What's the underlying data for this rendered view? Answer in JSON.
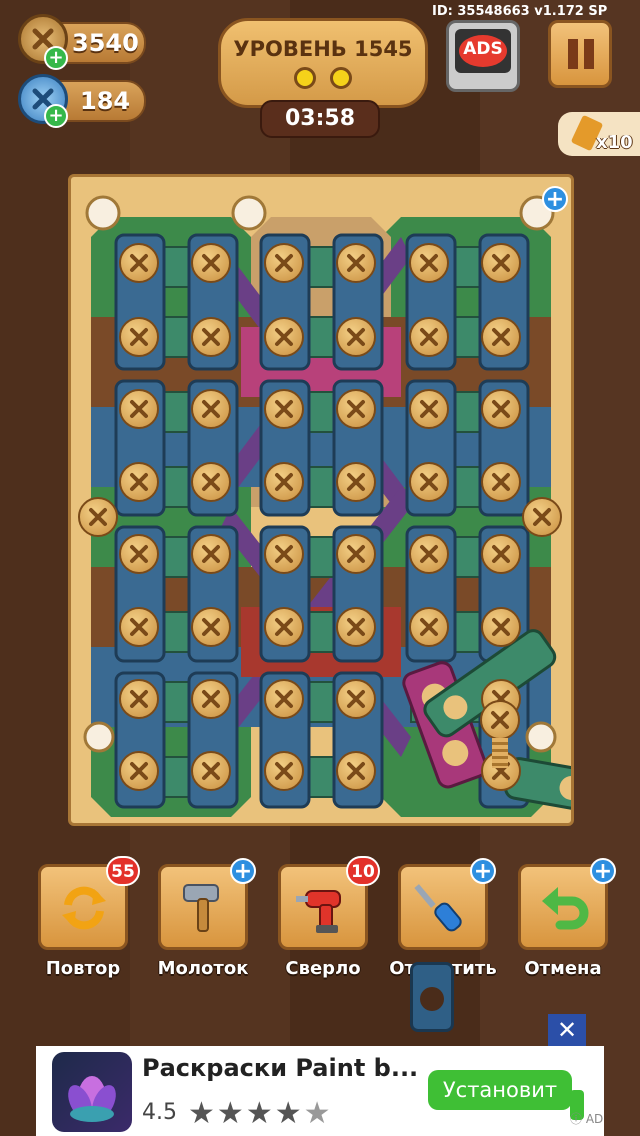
{
  "hud": {
    "coins": "3540",
    "gems": "184",
    "build_info": "ID: 35548663 v1.172 SP",
    "level_label": "УРОВЕНЬ 1545",
    "timer": "03:58",
    "ads_label": "ADS",
    "hint_count": "x10"
  },
  "toolbar": [
    {
      "name": "tool-replay",
      "label": "Повтор",
      "badge": "55",
      "badge_type": "count",
      "icon": "replay-arrows-icon"
    },
    {
      "name": "tool-hammer",
      "label": "Молоток",
      "badge": "+",
      "badge_type": "plus",
      "icon": "hammer-icon"
    },
    {
      "name": "tool-drill",
      "label": "Сверло",
      "badge": "10",
      "badge_type": "count",
      "icon": "drill-icon"
    },
    {
      "name": "tool-unscrew",
      "label": "Открутить",
      "badge": "+",
      "badge_type": "plus",
      "icon": "screwdriver-icon"
    },
    {
      "name": "tool-undo",
      "label": "Отмена",
      "badge": "+",
      "badge_type": "plus",
      "icon": "undo-arrow-icon"
    }
  ],
  "ad": {
    "title": "Раскраски Paint b...",
    "rating": "4.5",
    "stars_filled": 4,
    "stars_half": 1,
    "install_label": "Установит",
    "close_label": "✕",
    "ad_mark": "AD"
  },
  "colors": {
    "board_wood": "#e9c27c",
    "plank_blue": "#3a6a92",
    "plank_green": "#3d8a6a",
    "plank_purple": "#6a3f86",
    "plank_brown": "#7a4a28",
    "screw": "#e2b063",
    "install_green": "#3fbf35",
    "badge_red": "#e3312a",
    "badge_blue": "#2d8fe0"
  }
}
